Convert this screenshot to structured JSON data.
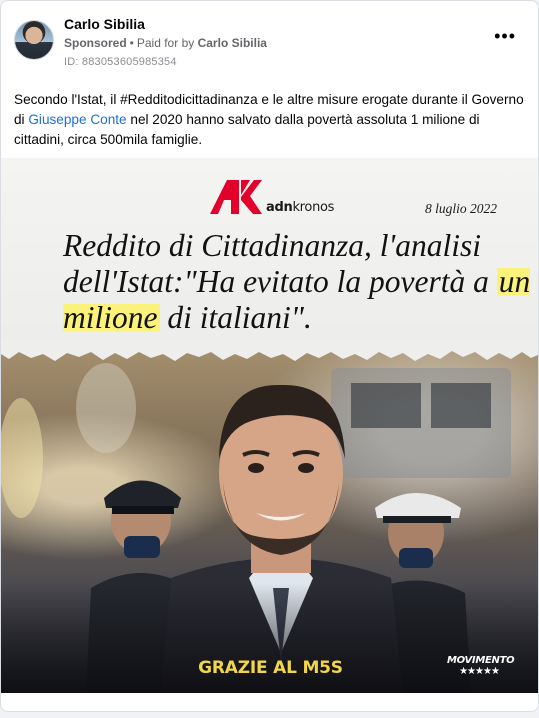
{
  "post": {
    "author": "Carlo Sibilia",
    "sponsored_label": "Sponsored",
    "separator": "•",
    "paid_for_prefix": "Paid for by",
    "paid_for_name": "Carlo Sibilia",
    "ad_id": "ID: 883053605985354",
    "more_icon": "more-options-icon",
    "text_before_link": "Secondo l'Istat, il #Redditodicittadinanza e le altre misure erogate durante il Governo di ",
    "link_text": "Giuseppe Conte",
    "text_after_link": " nel 2020 hanno salvato dalla povertà assoluta 1 milione di cittadini, circa 500mila famiglie."
  },
  "image": {
    "logo_prefix": "adn",
    "logo_suffix": "kronos",
    "date": "8 luglio 2022",
    "headline_part1": "Reddito di Cittadinanza, l'analisi dell'Istat:\"Ha evitato la povertà a ",
    "headline_highlight": "un milione",
    "headline_part2": " di italiani\".",
    "footer_text": "GRAZIE AL M5S",
    "badge_word": "MOVIMENTO",
    "badge_stars": "★★★★★"
  },
  "colors": {
    "link": "#216fdb",
    "logo_red": "#e3002b",
    "highlight": "#fbf27b",
    "footer_yellow": "#f1d64a"
  }
}
